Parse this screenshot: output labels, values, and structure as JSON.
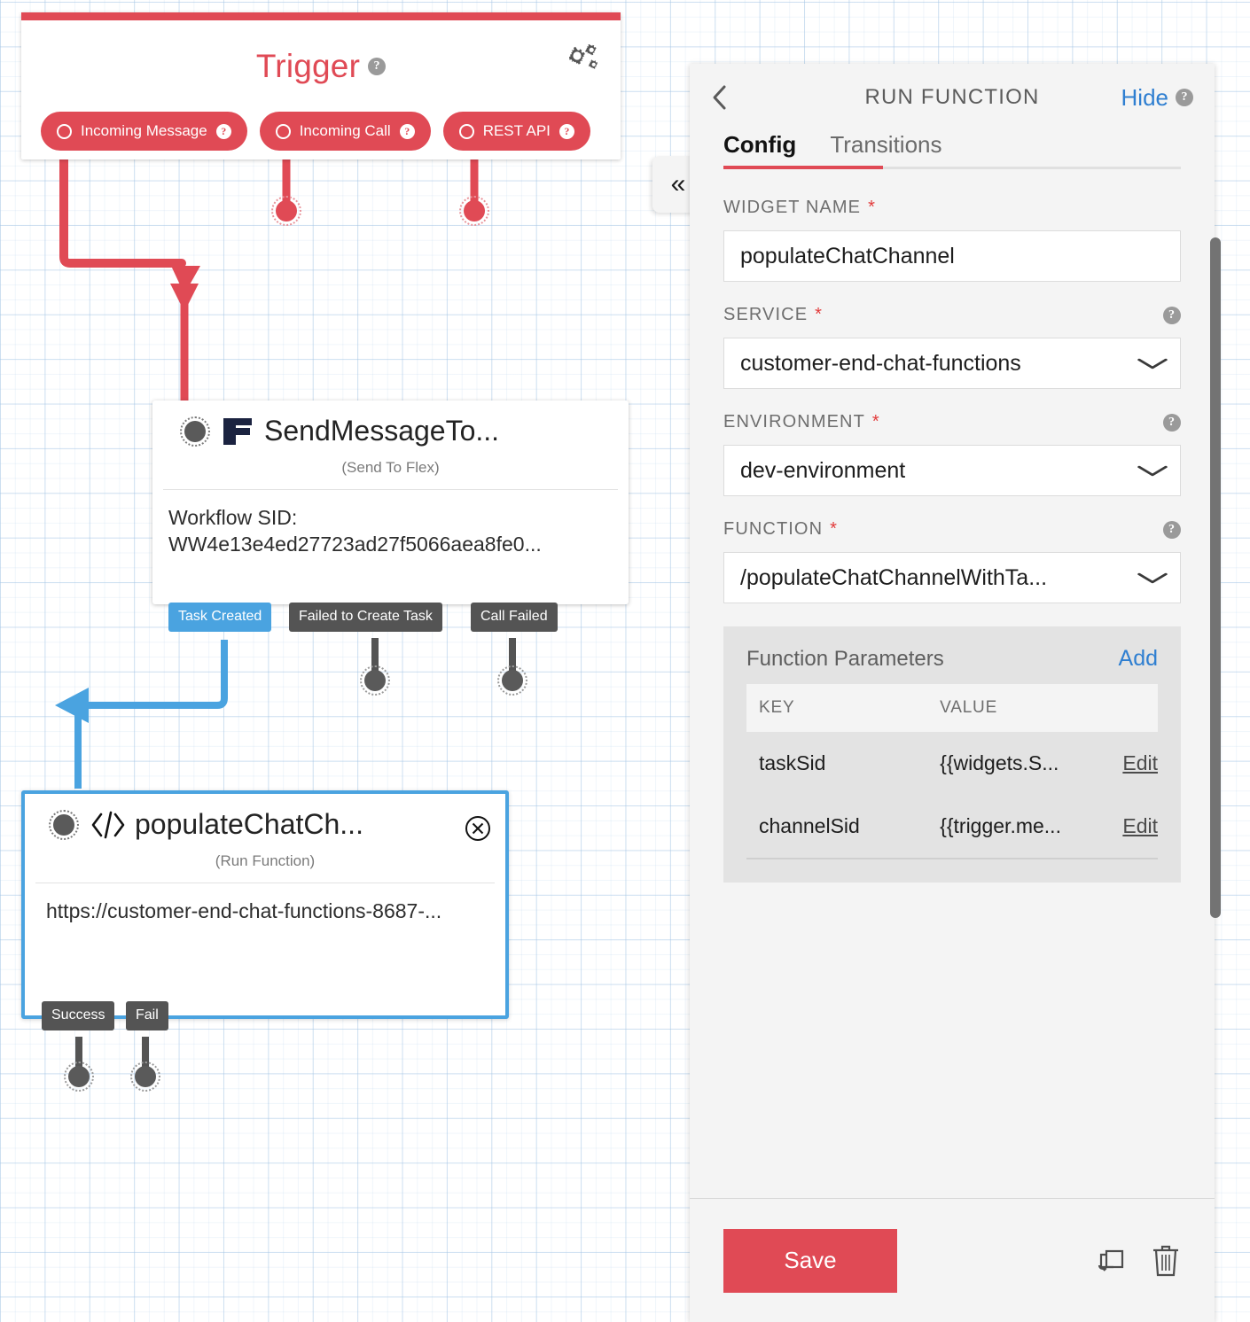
{
  "canvas": {
    "trigger": {
      "title": "Trigger",
      "help_icon": "help-circle-icon",
      "gear_icon": "gears-icon",
      "pills": [
        {
          "label": "Incoming Message",
          "icon": "circle-outline-icon",
          "help": "help-circle-icon"
        },
        {
          "label": "Incoming Call",
          "icon": "circle-outline-icon",
          "help": "help-circle-icon"
        },
        {
          "label": "REST API",
          "icon": "circle-outline-icon",
          "help": "help-circle-icon"
        }
      ],
      "accent_color": "#e04a55"
    },
    "widgets": [
      {
        "name": "SendMessageTo...",
        "type_label": "(Send To Flex)",
        "icon": "twilio-flex-logo-icon",
        "body_label": "Workflow SID:",
        "body_value": "WW4e13e4ed27723ad27f5066aea8fe0...",
        "outputs": [
          {
            "label": "Task Created",
            "color": "#4aa3e0"
          },
          {
            "label": "Failed to Create Task",
            "color": "#545454"
          },
          {
            "label": "Call Failed",
            "color": "#545454"
          }
        ]
      },
      {
        "name": "populateChatCh...",
        "type_label": "(Run Function)",
        "icon": "code-brackets-icon",
        "close_icon": "close-circle-icon",
        "body_value": "https://customer-end-chat-functions-8687-...",
        "selected": true,
        "outputs": [
          {
            "label": "Success",
            "color": "#545454"
          },
          {
            "label": "Fail",
            "color": "#545454"
          }
        ]
      }
    ],
    "collapse_tab": {
      "icon": "double-chevron-left-icon",
      "glyph": "«"
    }
  },
  "panel": {
    "header": {
      "back_icon": "chevron-left-icon",
      "title": "RUN FUNCTION",
      "hide_label": "Hide",
      "help_icon": "help-circle-icon"
    },
    "tabs": [
      {
        "label": "Config",
        "active": true
      },
      {
        "label": "Transitions",
        "active": false
      }
    ],
    "fields": [
      {
        "label": "WIDGET NAME",
        "required": true,
        "kind": "text",
        "value": "populateChatChannel",
        "has_help": false
      },
      {
        "label": "SERVICE",
        "required": true,
        "kind": "select",
        "value": "customer-end-chat-functions",
        "has_help": true,
        "caret_icon": "chevron-down-icon"
      },
      {
        "label": "ENVIRONMENT",
        "required": true,
        "kind": "select",
        "value": "dev-environment",
        "has_help": true,
        "caret_icon": "chevron-down-icon"
      },
      {
        "label": "FUNCTION",
        "required": true,
        "kind": "select",
        "value": "/populateChatChannelWithTa...",
        "has_help": true,
        "caret_icon": "chevron-down-icon"
      }
    ],
    "parameters": {
      "title": "Function Parameters",
      "add_label": "Add",
      "columns": [
        "KEY",
        "VALUE"
      ],
      "edit_label": "Edit",
      "rows": [
        {
          "key": "taskSid",
          "value": "{{widgets.S..."
        },
        {
          "key": "channelSid",
          "value": "{{trigger.me..."
        }
      ]
    },
    "footer": {
      "save_label": "Save",
      "copy_icon": "duplicate-icon",
      "delete_icon": "trash-icon"
    },
    "scrollbar": "vertical-scrollbar"
  },
  "colors": {
    "brand_red": "#e04a55",
    "link_blue": "#2f7fd1",
    "connector_blue": "#4aa3e0",
    "chip_grey": "#545454",
    "panel_bg": "#f4f4f4"
  }
}
